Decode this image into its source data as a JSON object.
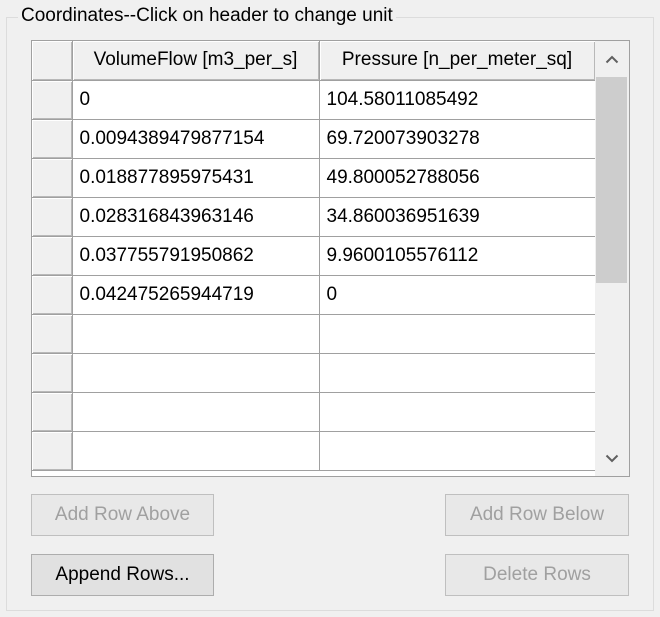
{
  "group": {
    "title": "Coordinates--Click on header to change unit"
  },
  "table": {
    "columns": [
      "VolumeFlow [m3_per_s]",
      "Pressure [n_per_meter_sq]"
    ],
    "rows": [
      [
        "0",
        "104.58011085492"
      ],
      [
        "0.0094389479877154",
        "69.720073903278"
      ],
      [
        "0.018877895975431",
        "49.800052788056"
      ],
      [
        "0.028316843963146",
        "34.860036951639"
      ],
      [
        "0.037755791950862",
        "9.9600105576112"
      ],
      [
        "0.042475265944719",
        "0"
      ],
      [
        "",
        ""
      ],
      [
        "",
        ""
      ],
      [
        "",
        ""
      ],
      [
        "",
        ""
      ]
    ]
  },
  "scrollbar": {
    "up_icon": "chevron-up-icon",
    "down_icon": "chevron-down-icon"
  },
  "buttons": {
    "add_row_above": "Add Row Above",
    "add_row_below": "Add Row Below",
    "append_rows": "Append Rows...",
    "delete_rows": "Delete Rows"
  }
}
